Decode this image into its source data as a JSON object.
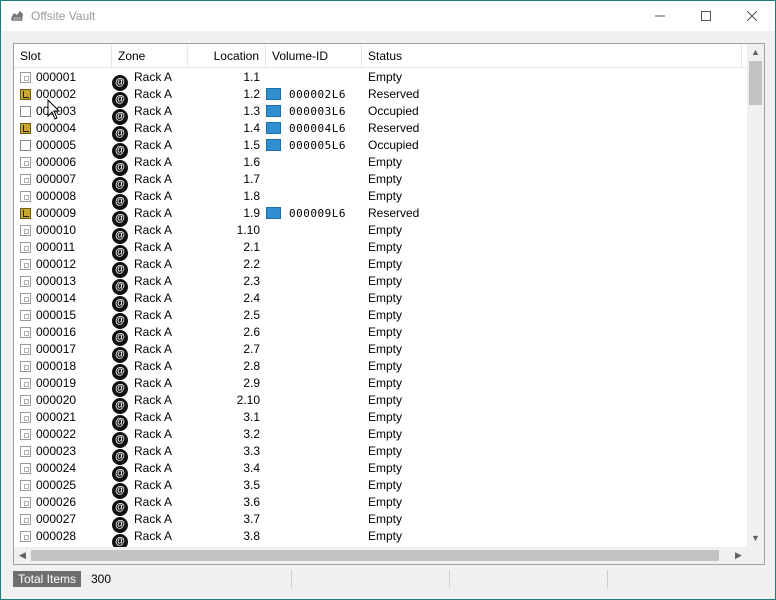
{
  "window": {
    "title": "Offsite Vault",
    "icon": "vault-icon",
    "controls": {
      "minimize": "minimize-icon",
      "maximize": "maximize-icon",
      "close": "close-icon"
    }
  },
  "columns": {
    "slot": "Slot",
    "zone": "Zone",
    "location": "Location",
    "volume_id": "Volume-ID",
    "status": "Status"
  },
  "rows": [
    {
      "slot": "000001",
      "slot_state": "empty",
      "zone": "Rack A",
      "location": "1.1",
      "volume_id": "",
      "status": "Empty"
    },
    {
      "slot": "000002",
      "slot_state": "reserved",
      "zone": "Rack A",
      "location": "1.2",
      "volume_id": "000002L6",
      "status": "Reserved"
    },
    {
      "slot": "000003",
      "slot_state": "occupied",
      "zone": "Rack A",
      "location": "1.3",
      "volume_id": "000003L6",
      "status": "Occupied"
    },
    {
      "slot": "000004",
      "slot_state": "reserved",
      "zone": "Rack A",
      "location": "1.4",
      "volume_id": "000004L6",
      "status": "Reserved"
    },
    {
      "slot": "000005",
      "slot_state": "occupied",
      "zone": "Rack A",
      "location": "1.5",
      "volume_id": "000005L6",
      "status": "Occupied"
    },
    {
      "slot": "000006",
      "slot_state": "empty",
      "zone": "Rack A",
      "location": "1.6",
      "volume_id": "",
      "status": "Empty"
    },
    {
      "slot": "000007",
      "slot_state": "empty",
      "zone": "Rack A",
      "location": "1.7",
      "volume_id": "",
      "status": "Empty"
    },
    {
      "slot": "000008",
      "slot_state": "empty",
      "zone": "Rack A",
      "location": "1.8",
      "volume_id": "",
      "status": "Empty"
    },
    {
      "slot": "000009",
      "slot_state": "reserved",
      "zone": "Rack A",
      "location": "1.9",
      "volume_id": "000009L6",
      "status": "Reserved"
    },
    {
      "slot": "000010",
      "slot_state": "empty",
      "zone": "Rack A",
      "location": "1.10",
      "volume_id": "",
      "status": "Empty"
    },
    {
      "slot": "000011",
      "slot_state": "empty",
      "zone": "Rack A",
      "location": "2.1",
      "volume_id": "",
      "status": "Empty"
    },
    {
      "slot": "000012",
      "slot_state": "empty",
      "zone": "Rack A",
      "location": "2.2",
      "volume_id": "",
      "status": "Empty"
    },
    {
      "slot": "000013",
      "slot_state": "empty",
      "zone": "Rack A",
      "location": "2.3",
      "volume_id": "",
      "status": "Empty"
    },
    {
      "slot": "000014",
      "slot_state": "empty",
      "zone": "Rack A",
      "location": "2.4",
      "volume_id": "",
      "status": "Empty"
    },
    {
      "slot": "000015",
      "slot_state": "empty",
      "zone": "Rack A",
      "location": "2.5",
      "volume_id": "",
      "status": "Empty"
    },
    {
      "slot": "000016",
      "slot_state": "empty",
      "zone": "Rack A",
      "location": "2.6",
      "volume_id": "",
      "status": "Empty"
    },
    {
      "slot": "000017",
      "slot_state": "empty",
      "zone": "Rack A",
      "location": "2.7",
      "volume_id": "",
      "status": "Empty"
    },
    {
      "slot": "000018",
      "slot_state": "empty",
      "zone": "Rack A",
      "location": "2.8",
      "volume_id": "",
      "status": "Empty"
    },
    {
      "slot": "000019",
      "slot_state": "empty",
      "zone": "Rack A",
      "location": "2.9",
      "volume_id": "",
      "status": "Empty"
    },
    {
      "slot": "000020",
      "slot_state": "empty",
      "zone": "Rack A",
      "location": "2.10",
      "volume_id": "",
      "status": "Empty"
    },
    {
      "slot": "000021",
      "slot_state": "empty",
      "zone": "Rack A",
      "location": "3.1",
      "volume_id": "",
      "status": "Empty"
    },
    {
      "slot": "000022",
      "slot_state": "empty",
      "zone": "Rack A",
      "location": "3.2",
      "volume_id": "",
      "status": "Empty"
    },
    {
      "slot": "000023",
      "slot_state": "empty",
      "zone": "Rack A",
      "location": "3.3",
      "volume_id": "",
      "status": "Empty"
    },
    {
      "slot": "000024",
      "slot_state": "empty",
      "zone": "Rack A",
      "location": "3.4",
      "volume_id": "",
      "status": "Empty"
    },
    {
      "slot": "000025",
      "slot_state": "empty",
      "zone": "Rack A",
      "location": "3.5",
      "volume_id": "",
      "status": "Empty"
    },
    {
      "slot": "000026",
      "slot_state": "empty",
      "zone": "Rack A",
      "location": "3.6",
      "volume_id": "",
      "status": "Empty"
    },
    {
      "slot": "000027",
      "slot_state": "empty",
      "zone": "Rack A",
      "location": "3.7",
      "volume_id": "",
      "status": "Empty"
    },
    {
      "slot": "000028",
      "slot_state": "empty",
      "zone": "Rack A",
      "location": "3.8",
      "volume_id": "",
      "status": "Empty"
    }
  ],
  "statusbar": {
    "label": "Total Items",
    "value": "300"
  },
  "icons": {
    "zone": "zone-at-icon",
    "volume": "tape-volume-icon",
    "cursor": "mouse-pointer-icon"
  },
  "colors": {
    "reserved_slot": "#c8a830",
    "volume_icon": "#2f8fd0",
    "status_label_bg": "#6e6e6e",
    "window_border": "#1e7b7b"
  }
}
